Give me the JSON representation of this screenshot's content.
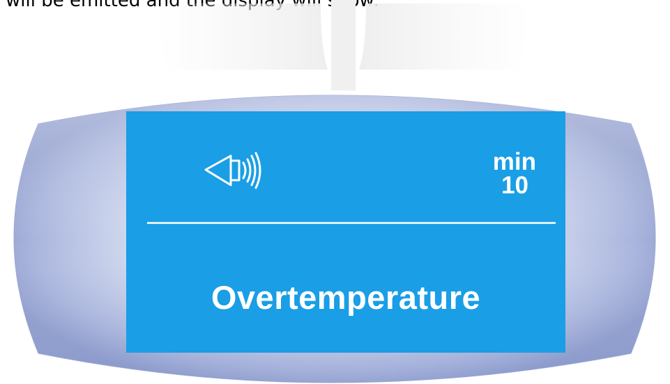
{
  "intro_text": "will be emitted and the display will show:",
  "display": {
    "icon": "speaker-sound-icon",
    "timer_unit": "min",
    "timer_value": "10",
    "message": "Overtemperature"
  },
  "colors": {
    "screen": "#1a9ee6",
    "housing_center": "#e4e8f5",
    "housing_edge": "#93a0cf",
    "text": "#ffffff"
  }
}
